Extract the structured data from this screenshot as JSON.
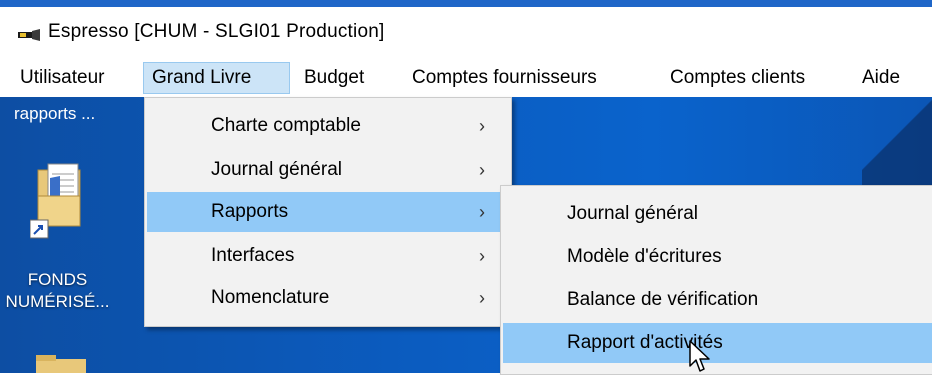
{
  "window": {
    "title": "Espresso  [CHUM - SLGI01  Production]"
  },
  "menubar": {
    "items": [
      {
        "label": "Utilisateur"
      },
      {
        "label": "Grand Livre"
      },
      {
        "label": "Budget"
      },
      {
        "label": "Comptes fournisseurs"
      },
      {
        "label": "Comptes clients"
      },
      {
        "label": "Aide"
      }
    ]
  },
  "desktop": {
    "top_label": "rapports ...",
    "folder_label_line1": "FONDS",
    "folder_label_line2": "NUMÉRISÉ..."
  },
  "grand_livre_menu": {
    "items": [
      {
        "label": "Charte comptable",
        "submenu": true
      },
      {
        "label": "Journal général",
        "submenu": true
      },
      {
        "label": "Rapports",
        "submenu": true,
        "highlighted": true
      },
      {
        "label": "Interfaces",
        "submenu": true
      },
      {
        "label": "Nomenclature",
        "submenu": true
      }
    ],
    "arrow_glyph": "›"
  },
  "rapports_submenu": {
    "items": [
      {
        "label": "Journal général"
      },
      {
        "label": "Modèle d'écritures"
      },
      {
        "label": "Balance de vérification"
      },
      {
        "label": "Rapport d'activités",
        "highlighted": true
      }
    ]
  },
  "colors": {
    "highlight": "#91c9f7",
    "menu_bg": "#f2f2f2",
    "active_menubar": "#cce4f7",
    "desktop": "#0b5cc0"
  },
  "icons": [
    "app-icon",
    "folder-shortcut-icon",
    "shortcut-arrow-icon",
    "mouse-cursor-icon"
  ]
}
